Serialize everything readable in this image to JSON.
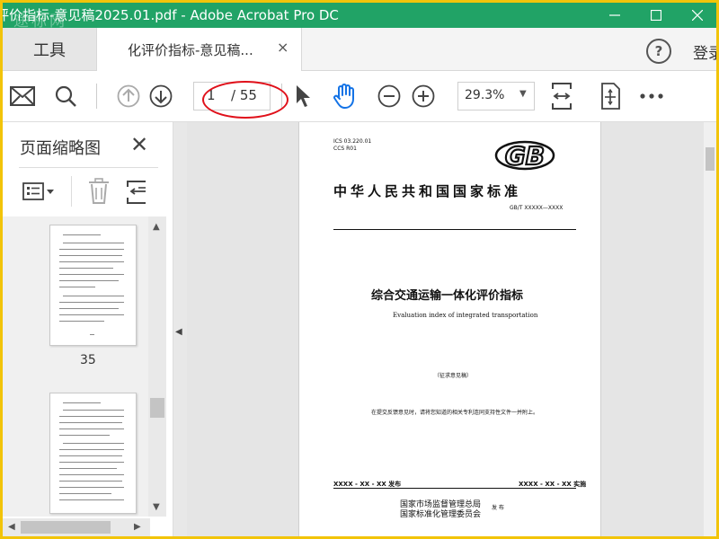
{
  "window": {
    "title": "评价指标-意见稿2025.01.pdf - Adobe Acrobat Pro DC",
    "watermark": "途标网"
  },
  "tabs": {
    "tools": "工具",
    "doc": "化评价指标-意见稿...",
    "close": "×",
    "login": "登录",
    "help": "?"
  },
  "toolbar": {
    "current_page": "1",
    "total_pages": "/ 55",
    "zoom": "29.3%"
  },
  "panel": {
    "title": "页面缩略图",
    "close": "✕",
    "page_number": "35"
  },
  "document": {
    "ics": "ICS  03.220.01",
    "ccs": "CCS  R01",
    "logo": "GB",
    "national_standard": "中华人民共和国国家标准",
    "code": "GB/T XXXXX—XXXX",
    "title_cn": "综合交通运输一体化评价指标",
    "title_en": "Evaluation index of integrated transportation",
    "draft": "（征求意见稿）",
    "notice": "在提交反馈意见时，请将您知道的相关专利连同支持性文件一并附上。",
    "publish": "XXXX - XX - XX 发布",
    "implement": "XXXX - XX - XX 实施",
    "issuer1": "国家市场监督管理总局",
    "issuer2": "国家标准化管理委员会",
    "issue": "发 布"
  },
  "icons": [
    "mail-icon",
    "search-icon",
    "prev-page-icon",
    "next-page-icon",
    "select-arrow-icon",
    "hand-icon",
    "zoom-out-icon",
    "zoom-in-icon",
    "fit-page-icon",
    "scroll-mode-icon",
    "more-icon"
  ],
  "colors": {
    "titlebar": "#21a366",
    "frame": "#f2c40a",
    "annotation": "#e0101a",
    "hand": "#1473e6"
  }
}
